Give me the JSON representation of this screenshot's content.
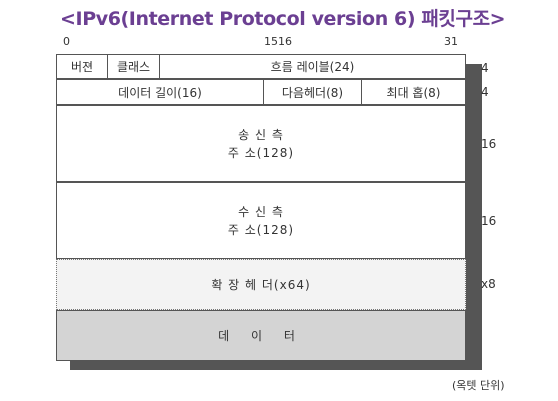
{
  "title": "<IPv6(Internet Protocol version 6) 패킷구조>",
  "bit_labels": {
    "start": "0",
    "mid": "1516",
    "end": "31"
  },
  "header": {
    "row1": {
      "version": "버젼",
      "class": "클래스",
      "flow_label": "흐름 레이블(24)",
      "octets": "4"
    },
    "row2": {
      "payload_length": "데이터 길이(16)",
      "next_header": "다음헤더(8)",
      "hop_limit": "최대 홉(8)",
      "octets": "4"
    },
    "source": {
      "line1": "송 신 측",
      "line2": "주 소(128)",
      "octets": "16"
    },
    "destination": {
      "line1": "수 신 측",
      "line2": "주 소(128)",
      "octets": "16"
    },
    "extension": {
      "label": "확 장 헤 더(x64)",
      "octets": "x8"
    },
    "data": {
      "label": "데 이 터"
    }
  },
  "unit_note": "(옥텟 단위)",
  "colors": {
    "title": "#6b3f92",
    "shadow": "#555555",
    "data_fill": "#d4d4d4",
    "ext_fill": "#f3f3f3"
  }
}
